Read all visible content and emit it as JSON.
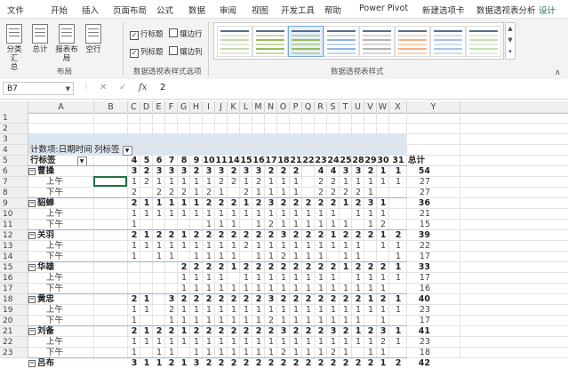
{
  "tabs": [
    "文件",
    "开始",
    "插入",
    "页面布局",
    "公式",
    "数据",
    "审阅",
    "视图",
    "开发工具",
    "帮助",
    "Power Pivot",
    "新建选项卡",
    "数据透视表分析",
    "设计"
  ],
  "active_tab_index": 13,
  "ribbon": {
    "layout_buttons": [
      "分类汇\n总",
      "总计",
      "报表布\n局",
      "空行"
    ],
    "layout_group": "布局",
    "style_options": [
      {
        "label": "行标题",
        "checked": true
      },
      {
        "label": "镶边行",
        "checked": false
      },
      {
        "label": "列标题",
        "checked": true
      },
      {
        "label": "镶边列",
        "checked": false
      }
    ],
    "style_options_group": "数据透视表样式选项",
    "styles_group": "数据透视表样式"
  },
  "formula_bar": {
    "name_box": "B7",
    "cancel": "✕",
    "enter": "✓",
    "fx": "fx",
    "value": "2"
  },
  "columns": [
    "A",
    "B",
    "C",
    "D",
    "E",
    "F",
    "G",
    "H",
    "I",
    "J",
    "K",
    "L",
    "M",
    "N",
    "O",
    "P",
    "Q",
    "R",
    "S",
    "T",
    "U",
    "V",
    "W",
    "X",
    "Y"
  ],
  "row_numbers": [
    "1",
    "2",
    "3",
    "4",
    "5",
    "6",
    "7",
    "8",
    "9",
    "10",
    "11",
    "12",
    "13",
    "14",
    "15",
    "16",
    "17",
    "18",
    "19",
    "20",
    "21",
    "22",
    "23"
  ],
  "pivot": {
    "value_label": "计数项:日期时间",
    "col_label": "列标签",
    "row_label": "行标签",
    "headers": [
      "4",
      "5",
      "6",
      "7",
      "8",
      "9",
      "10",
      "11",
      "14",
      "15",
      "16",
      "17",
      "18",
      "21",
      "22",
      "23",
      "24",
      "25",
      "28",
      "29",
      "30",
      "31"
    ],
    "total_label": "总计",
    "rows": [
      {
        "label": "曹操",
        "type": "group",
        "values": [
          "3",
          "2",
          "3",
          "3",
          "3",
          "2",
          "3",
          "3",
          "2",
          "3",
          "3",
          "2",
          "2",
          "2",
          "",
          "4",
          "4",
          "3",
          "3",
          "2",
          "1",
          "1"
        ],
        "total": "54"
      },
      {
        "label": "上午",
        "type": "sub",
        "values": [
          "1",
          "2",
          "1",
          "1",
          "1",
          "1",
          "1",
          "2",
          "2",
          "1",
          "2",
          "1",
          "1",
          "1",
          "",
          "2",
          "2",
          "1",
          "1",
          "1",
          "1",
          "1"
        ],
        "total": "27"
      },
      {
        "label": "下午",
        "type": "sub",
        "values": [
          "2",
          "",
          "2",
          "2",
          "2",
          "1",
          "2",
          "1",
          "",
          "2",
          "1",
          "1",
          "1",
          "1",
          "",
          "2",
          "2",
          "2",
          "2",
          "1",
          "",
          ""
        ],
        "total": "27"
      },
      {
        "label": "貂蝉",
        "type": "group",
        "values": [
          "2",
          "1",
          "1",
          "1",
          "1",
          "1",
          "2",
          "2",
          "2",
          "1",
          "2",
          "3",
          "2",
          "2",
          "2",
          "2",
          "2",
          "1",
          "2",
          "3",
          "1",
          ""
        ],
        "total": "36"
      },
      {
        "label": "上午",
        "type": "sub",
        "values": [
          "1",
          "1",
          "1",
          "1",
          "1",
          "1",
          "1",
          "1",
          "1",
          "1",
          "1",
          "1",
          "1",
          "1",
          "1",
          "1",
          "1",
          "",
          "1",
          "1",
          "1",
          ""
        ],
        "total": "21"
      },
      {
        "label": "下午",
        "type": "sub",
        "values": [
          "1",
          "",
          "",
          "",
          "",
          "",
          "1",
          "1",
          "1",
          "",
          "1",
          "2",
          "1",
          "1",
          "1",
          "1",
          "1",
          "1",
          "",
          "1",
          "2",
          ""
        ],
        "total": "15"
      },
      {
        "label": "关羽",
        "type": "group",
        "values": [
          "2",
          "1",
          "2",
          "2",
          "1",
          "2",
          "2",
          "2",
          "2",
          "2",
          "2",
          "2",
          "3",
          "2",
          "2",
          "2",
          "1",
          "2",
          "2",
          "2",
          "1",
          "2"
        ],
        "total": "39"
      },
      {
        "label": "上午",
        "type": "sub",
        "values": [
          "1",
          "1",
          "1",
          "1",
          "1",
          "1",
          "1",
          "1",
          "1",
          "2",
          "1",
          "1",
          "1",
          "1",
          "1",
          "1",
          "1",
          "1",
          "1",
          "",
          "1",
          "1"
        ],
        "total": "22"
      },
      {
        "label": "下午",
        "type": "sub",
        "values": [
          "1",
          "",
          "1",
          "1",
          "",
          "1",
          "1",
          "1",
          "1",
          "",
          "1",
          "1",
          "2",
          "1",
          "1",
          "1",
          "",
          "1",
          "1",
          "",
          "",
          "1"
        ],
        "total": "17"
      },
      {
        "label": "华雄",
        "type": "group",
        "values": [
          "",
          "",
          "",
          "",
          "2",
          "2",
          "2",
          "2",
          "1",
          "2",
          "2",
          "2",
          "2",
          "2",
          "2",
          "2",
          "2",
          "1",
          "2",
          "2",
          "2",
          "1"
        ],
        "total": "33"
      },
      {
        "label": "上午",
        "type": "sub",
        "values": [
          "",
          "",
          "",
          "",
          "1",
          "1",
          "1",
          "1",
          "",
          "1",
          "1",
          "1",
          "1",
          "1",
          "1",
          "1",
          "1",
          "",
          "1",
          "1",
          "1",
          "1"
        ],
        "total": "17"
      },
      {
        "label": "下午",
        "type": "sub",
        "values": [
          "",
          "",
          "",
          "",
          "1",
          "1",
          "1",
          "1",
          "1",
          "1",
          "1",
          "1",
          "1",
          "1",
          "1",
          "1",
          "1",
          "1",
          "1",
          "1",
          "1",
          ""
        ],
        "total": "16"
      },
      {
        "label": "黄忠",
        "type": "group",
        "values": [
          "2",
          "1",
          "",
          "3",
          "2",
          "2",
          "2",
          "2",
          "2",
          "2",
          "2",
          "3",
          "2",
          "2",
          "2",
          "2",
          "2",
          "2",
          "2",
          "1",
          "2",
          "1"
        ],
        "total": "40"
      },
      {
        "label": "上午",
        "type": "sub",
        "values": [
          "1",
          "1",
          "",
          "2",
          "1",
          "1",
          "1",
          "1",
          "1",
          "1",
          "1",
          "1",
          "1",
          "1",
          "1",
          "1",
          "1",
          "1",
          "1",
          "1",
          "1",
          "1"
        ],
        "total": "23"
      },
      {
        "label": "下午",
        "type": "sub",
        "values": [
          "1",
          "",
          "",
          "1",
          "1",
          "1",
          "1",
          "1",
          "1",
          "1",
          "1",
          "2",
          "1",
          "1",
          "1",
          "1",
          "1",
          "1",
          "1",
          "",
          "1",
          ""
        ],
        "total": "17"
      },
      {
        "label": "刘备",
        "type": "group",
        "values": [
          "2",
          "1",
          "2",
          "2",
          "1",
          "2",
          "2",
          "2",
          "2",
          "2",
          "2",
          "2",
          "3",
          "2",
          "2",
          "2",
          "3",
          "2",
          "1",
          "2",
          "3",
          "1"
        ],
        "total": "41"
      },
      {
        "label": "上午",
        "type": "sub",
        "values": [
          "1",
          "1",
          "1",
          "1",
          "1",
          "1",
          "1",
          "1",
          "1",
          "1",
          "1",
          "1",
          "1",
          "1",
          "1",
          "1",
          "1",
          "1",
          "1",
          "1",
          "2",
          "1"
        ],
        "total": "23"
      },
      {
        "label": "下午",
        "type": "sub",
        "values": [
          "1",
          "",
          "1",
          "1",
          "",
          "1",
          "1",
          "1",
          "1",
          "1",
          "1",
          "1",
          "2",
          "1",
          "1",
          "1",
          "2",
          "1",
          "",
          "1",
          "1",
          ""
        ],
        "total": "18"
      },
      {
        "label": "吕布",
        "type": "group",
        "values": [
          "3",
          "1",
          "1",
          "2",
          "1",
          "3",
          "2",
          "2",
          "2",
          "2",
          "2",
          "2",
          "2",
          "2",
          "2",
          "2",
          "2",
          "2",
          "2",
          "2",
          "1",
          "2"
        ],
        "total": "42"
      }
    ]
  }
}
